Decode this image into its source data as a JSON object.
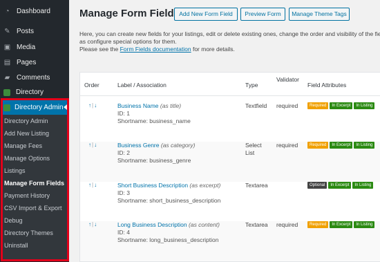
{
  "sidebar": {
    "menu": [
      {
        "label": "Dashboard",
        "icon": "dashboard-icon"
      },
      {
        "label": "Posts",
        "icon": "pin-icon"
      },
      {
        "label": "Media",
        "icon": "media-icon"
      },
      {
        "label": "Pages",
        "icon": "pages-icon"
      },
      {
        "label": "Comments",
        "icon": "comments-icon"
      },
      {
        "label": "Directory",
        "icon": "directory-icon"
      }
    ],
    "active": {
      "label": "Directory Admin",
      "icon": "directory-icon"
    },
    "submenu": [
      "Directory Admin",
      "Add New Listing",
      "Manage Fees",
      "Manage Options",
      "Listings",
      "Manage Form Fields",
      "Payment History",
      "CSV Import & Export",
      "Debug",
      "Directory Themes",
      "Uninstall"
    ],
    "current_submenu": "Manage Form Fields",
    "highlight_color": "#e2001a",
    "active_color": "#0073aa"
  },
  "header": {
    "title": "Manage Form Fields",
    "buttons": {
      "add": "Add New Form Field",
      "preview": "Preview Form",
      "theme": "Manage Theme Tags"
    }
  },
  "intro": {
    "line1": "Here, you can create new fields for your listings, edit or delete existing ones, change the order and visibility of the fields",
    "line2": "as configure special options for them.",
    "line3_pre": "Please see the ",
    "line3_link": "Form Fields documentation",
    "line3_post": " for more details."
  },
  "table": {
    "headers": {
      "order": "Order",
      "label": "Label / Association",
      "type": "Type",
      "validator": "Validator",
      "attributes": "Field Attributes"
    },
    "order_up": "↑",
    "order_sep": "|",
    "order_down": "↓",
    "rows": [
      {
        "name": "Business Name",
        "assoc": "(as title)",
        "id": "ID: 1",
        "shortname": "Shortname: business_name",
        "type": "Textfield",
        "validator": "required",
        "badges": [
          {
            "text": "Required",
            "color": "orange"
          },
          {
            "text": "In Excerpt",
            "color": "green"
          },
          {
            "text": "In Listing",
            "color": "green"
          }
        ]
      },
      {
        "name": "Business Genre",
        "assoc": "(as category)",
        "id": "ID: 2",
        "shortname": "Shortname: business_genre",
        "type": "Select List",
        "validator": "required",
        "badges": [
          {
            "text": "Required",
            "color": "orange"
          },
          {
            "text": "In Excerpt",
            "color": "green"
          },
          {
            "text": "In Listing",
            "color": "green"
          }
        ]
      },
      {
        "name": "Short Business Description",
        "assoc": "(as excerpt)",
        "id": "ID: 3",
        "shortname": "Shortname: short_business_description",
        "type": "Textarea",
        "validator": "",
        "badges": [
          {
            "text": "Optional",
            "color": "dark"
          },
          {
            "text": "In Excerpt",
            "color": "green"
          },
          {
            "text": "In Listing",
            "color": "green"
          }
        ]
      },
      {
        "name": "Long Business Description",
        "assoc": "(as content)",
        "id": "ID: 4",
        "shortname": "Shortname: long_business_description",
        "type": "Textarea",
        "validator": "required",
        "badges": [
          {
            "text": "Required",
            "color": "orange"
          },
          {
            "text": "In Excerpt",
            "color": "green"
          },
          {
            "text": "In Listing",
            "color": "green"
          }
        ]
      }
    ]
  }
}
